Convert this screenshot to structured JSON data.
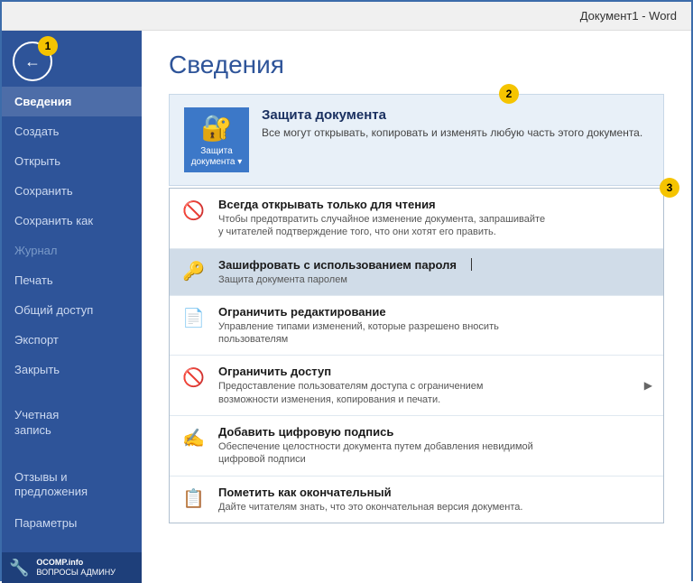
{
  "titlebar": {
    "text": "Документ1  -  Word"
  },
  "sidebar": {
    "back_button_title": "Назад",
    "annotation1_label": "1",
    "items": [
      {
        "label": "Сведения",
        "id": "svedeniya",
        "active": true
      },
      {
        "label": "Создать",
        "id": "sozdat"
      },
      {
        "label": "Открыть",
        "id": "otkryt"
      },
      {
        "label": "Сохранить",
        "id": "sokhranit"
      },
      {
        "label": "Сохранить как",
        "id": "sokhranit-kak"
      },
      {
        "label": "Журнал",
        "id": "zhurnal",
        "disabled": true
      },
      {
        "label": "Печать",
        "id": "pechat"
      },
      {
        "label": "Общий доступ",
        "id": "obshchiy-dostup"
      },
      {
        "label": "Экспорт",
        "id": "eksport"
      },
      {
        "label": "Закрыть",
        "id": "zakryt"
      },
      {
        "label": "Учетная\nзапись",
        "id": "uchetnaya-zapis",
        "multiline": true
      },
      {
        "label": "Отзывы и\nпредложения",
        "id": "otzyvy",
        "multiline": true
      },
      {
        "label": "Параметры",
        "id": "parametry"
      }
    ],
    "ocomp": {
      "label": "OCOMP.info",
      "sublabel": "ВОПРОСЫ АДМИНУ"
    }
  },
  "main": {
    "page_title": "Сведения",
    "annotation2_label": "2",
    "annotation3_label": "3",
    "protection_section": {
      "button_label": "Защита\nдокумента ▾",
      "title": "Защита документа",
      "description": "Все могут открывать, копировать и изменять любую часть этого документа."
    },
    "menu_items": [
      {
        "id": "always-readonly",
        "icon_type": "readonly",
        "title": "Всегда открывать только для чтения",
        "description": "Чтобы предотвратить случайное изменение документа, запрашивайте\nу читателей подтверждение того, что они хотят его править."
      },
      {
        "id": "encrypt-password",
        "icon_type": "lock",
        "title": "Зашифровать с использованием пароля",
        "description": "Защита документа паролем",
        "highlighted": true
      },
      {
        "id": "restrict-editing",
        "icon_type": "edit-restrict",
        "title": "Ограничить редактирование",
        "description": "Управление типами изменений, которые разрешено вносить\nпользователям"
      },
      {
        "id": "restrict-access",
        "icon_type": "access",
        "title": "Ограничить доступ",
        "description": "Предоставление пользователям доступа с ограничением\nвозможности изменения, копирования и печати.",
        "has_arrow": true
      },
      {
        "id": "digital-signature",
        "icon_type": "sign",
        "title": "Добавить цифровую подпись",
        "description": "Обеспечение целостности документа путем добавления невидимой\nцифровой подписи"
      },
      {
        "id": "mark-final",
        "icon_type": "final",
        "title": "Пометить как окончательный",
        "description": "Дайте читателям знать, что это окончательная версия документа."
      }
    ]
  }
}
